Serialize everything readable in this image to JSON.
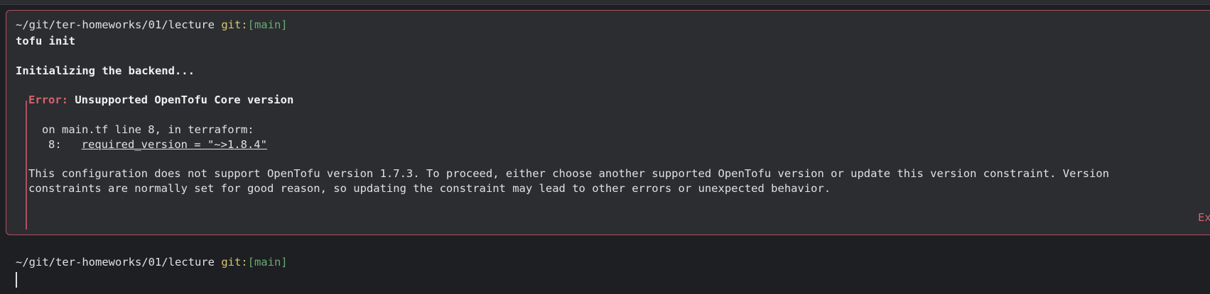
{
  "colors": {
    "background": "#1e1f22",
    "block_background": "#2b2d30",
    "error_border": "#b0505f",
    "error_text": "#d9626e",
    "git_label": "#d6c46e",
    "branch": "#6aab73"
  },
  "previous_block": {
    "prompt_path": "~/git/ter-homeworks/01/lecture",
    "git_label": "git:",
    "branch": "[main]",
    "command": "tofu init",
    "output": {
      "init_message": "Initializing the backend...",
      "error_label": "Error:",
      "error_title": "Unsupported OpenTofu Core version",
      "location": "on main.tf line 8, in terraform:",
      "line_number": "8:",
      "source_line": "required_version = \"~>1.8.4\"",
      "description_line1": "This configuration does not support OpenTofu version 1.7.3. To proceed, either choose another supported OpenTofu version or update this version constraint. Version",
      "description_line2": "constraints are normally set for good reason, so updating the constraint may lead to other errors or unexpected behavior."
    },
    "exit_badge": "Ex"
  },
  "current_prompt": {
    "prompt_path": "~/git/ter-homeworks/01/lecture",
    "git_label": "git:",
    "branch": "[main]"
  }
}
